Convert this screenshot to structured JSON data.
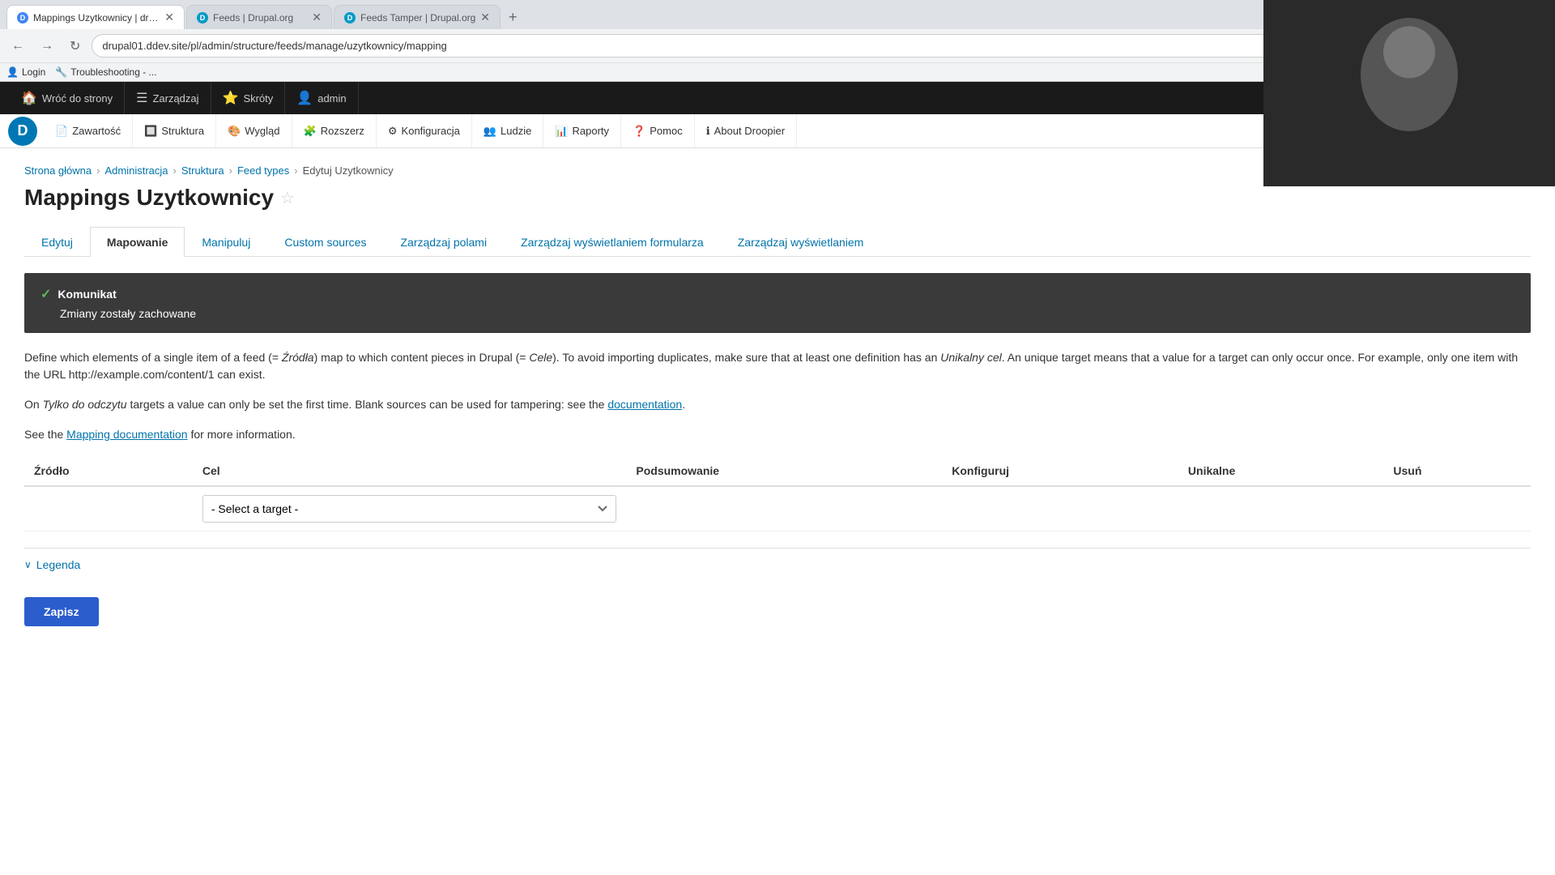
{
  "browser": {
    "tabs": [
      {
        "id": "tab1",
        "title": "Mappings Uzytkownicy | drc...",
        "url": "drupal01.ddev.site/pl/admin/structure/feeds/manage/uzytkownicy/mapping",
        "active": true,
        "favicon_color": "#4285f4",
        "favicon_letter": "D"
      },
      {
        "id": "tab2",
        "title": "Feeds | Drupal.org",
        "url": "drupal.org",
        "active": false,
        "favicon_color": "#009bc7",
        "favicon_letter": "D"
      },
      {
        "id": "tab3",
        "title": "Feeds Tamper | Drupal.org",
        "url": "drupal.org",
        "active": false,
        "favicon_color": "#009bc7",
        "favicon_letter": "D"
      }
    ],
    "new_tab_label": "+",
    "address": "drupal01.ddev.site/pl/admin/structure/feeds/manage/uzytkownicy/mapping",
    "bookmarks": [
      {
        "label": "Login",
        "icon": "👤"
      },
      {
        "label": "Troubleshooting - ...",
        "icon": "🔧"
      }
    ]
  },
  "admin_toolbar": {
    "items": [
      {
        "label": "Wróć do strony",
        "icon": "🏠"
      },
      {
        "label": "Zarządzaj",
        "icon": "☰"
      },
      {
        "label": "Skróty",
        "icon": "⭐"
      },
      {
        "label": "admin",
        "icon": "👤"
      }
    ]
  },
  "drupal_nav": {
    "logo_letter": "D",
    "items": [
      {
        "label": "Zawartość",
        "icon": "📄"
      },
      {
        "label": "Struktura",
        "icon": "🔲"
      },
      {
        "label": "Wygląd",
        "icon": "🎨"
      },
      {
        "label": "Rozszerz",
        "icon": "🧩"
      },
      {
        "label": "Konfiguracja",
        "icon": "⚙"
      },
      {
        "label": "Ludzie",
        "icon": "👥"
      },
      {
        "label": "Raporty",
        "icon": "📊"
      },
      {
        "label": "Pomoc",
        "icon": "❓"
      },
      {
        "label": "About Droopier",
        "icon": "ℹ"
      }
    ]
  },
  "breadcrumb": {
    "items": [
      {
        "label": "Strona główna",
        "href": "#"
      },
      {
        "label": "Administracja",
        "href": "#"
      },
      {
        "label": "Struktura",
        "href": "#"
      },
      {
        "label": "Feed types",
        "href": "#"
      },
      {
        "label": "Edytuj Uzytkownicy",
        "href": null
      }
    ]
  },
  "page": {
    "title": "Mappings Uzytkownicy",
    "tabs": [
      {
        "label": "Edytuj",
        "active": false
      },
      {
        "label": "Mapowanie",
        "active": true
      },
      {
        "label": "Manipuluj",
        "active": false
      },
      {
        "label": "Custom sources",
        "active": false
      },
      {
        "label": "Zarządzaj polami",
        "active": false
      },
      {
        "label": "Zarządzaj wyświetlaniem formularza",
        "active": false
      },
      {
        "label": "Zarządzaj wyświetlaniem",
        "active": false
      }
    ]
  },
  "message": {
    "type": "Komunikat",
    "text": "Zmiany zostały zachowane"
  },
  "description": {
    "para1_before": "Define which elements of a single item of a feed (= ",
    "para1_italic1": "Źródła",
    "para1_mid": ") map to which content pieces in Drupal (= ",
    "para1_italic2": "Cele",
    "para1_after": "). To avoid importing duplicates, make sure that at least one definition has an ",
    "para1_italic3": "Unikalny cel",
    "para1_end": ". An unique target means that a value for a target can only occur once. For example, only one item with the URL ",
    "para1_url": "http://example.com/content/1",
    "para1_final": " can exist.",
    "para2_before": "On ",
    "para2_italic": "Tylko do odczytu",
    "para2_mid": " targets a value can only be set the first time. Blank sources can be used for tampering: see the ",
    "para2_link": "documentation",
    "para2_end": ".",
    "para3_before": "See the ",
    "para3_link": "Mapping documentation",
    "para3_end": " for more information."
  },
  "table": {
    "headers": [
      "Źródło",
      "Cel",
      "Podsumowanie",
      "Konfiguruj",
      "Unikalne",
      "Usuń"
    ],
    "select_placeholder": "- Select a target -"
  },
  "legend": {
    "label": "Legenda",
    "expanded": false
  },
  "save_button": "Zapisz"
}
